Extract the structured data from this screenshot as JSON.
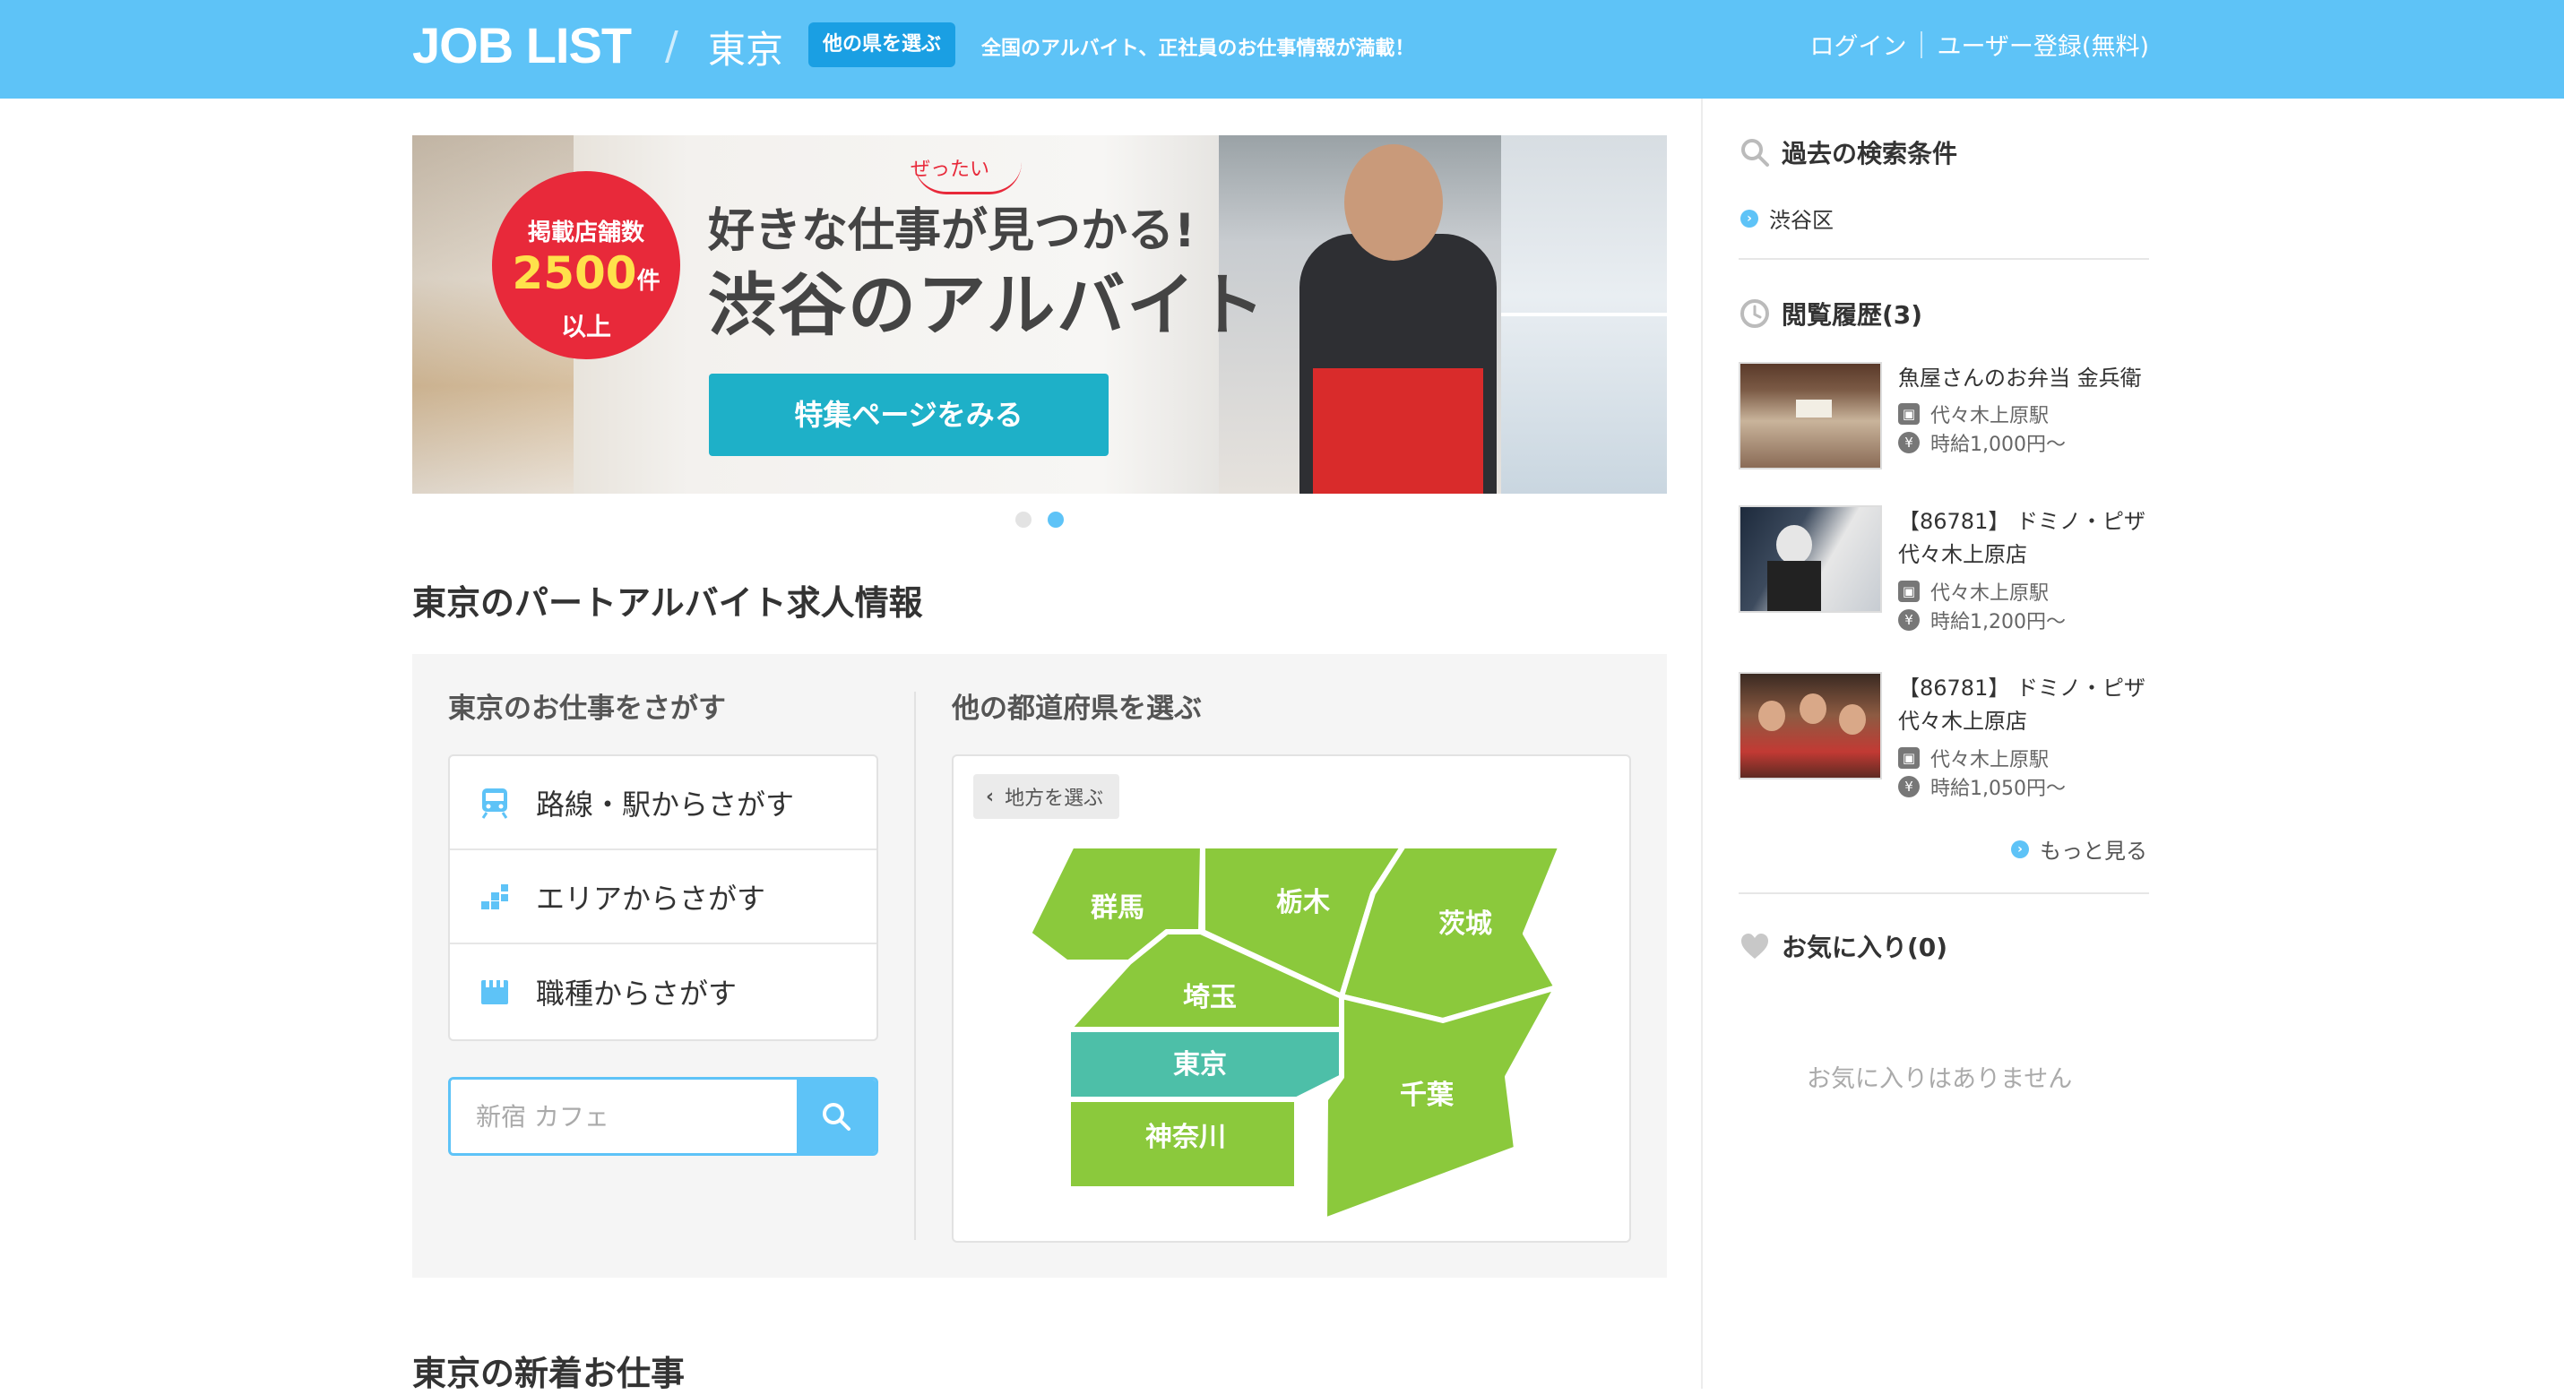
{
  "header": {
    "logo": "JOB LIST",
    "divider": "/",
    "prefecture": "東京",
    "change_pref_button": "他の県を選ぶ",
    "tagline": "全国のアルバイト、正社員のお仕事情報が満載！",
    "login": "ログイン",
    "register": "ユーザー登録(無料)"
  },
  "banner": {
    "badge_line1": "掲載店舗数",
    "badge_count": "2500",
    "badge_unit": "件",
    "badge_line3": "以上",
    "ruby": "ぜったい",
    "headline1": "好きな仕事が見つかる!",
    "headline2": "渋谷のアルバイト",
    "cta": "特集ページをみる",
    "slides": 2,
    "active_slide": 2
  },
  "main": {
    "section_title": "東京のパートアルバイト求人情報",
    "search_col_title": "東京のお仕事をさがす",
    "search_methods": [
      {
        "label": "路線・駅からさがす",
        "icon": "train-icon"
      },
      {
        "label": "エリアからさがす",
        "icon": "area-icon"
      },
      {
        "label": "職種からさがす",
        "icon": "job-category-icon"
      }
    ],
    "search_placeholder": "新宿 カフェ",
    "map_col_title": "他の都道府県を選ぶ",
    "region_button": "地方を選ぶ",
    "prefectures": [
      "群馬",
      "栃木",
      "茨城",
      "埼玉",
      "東京",
      "千葉",
      "神奈川"
    ],
    "selected_prefecture": "東京",
    "new_jobs_title": "東京の新着お仕事"
  },
  "sidebar": {
    "past_search_title": "過去の検索条件",
    "past_searches": [
      "渋谷区"
    ],
    "history_title": "閲覧履歴(3)",
    "history": [
      {
        "title": "魚屋さんのお弁当 金兵衛",
        "station": "代々木上原駅",
        "wage": "時給1,000円〜"
      },
      {
        "title": "【86781】 ドミノ・ピザ 代々木上原店",
        "station": "代々木上原駅",
        "wage": "時給1,200円〜"
      },
      {
        "title": "【86781】 ドミノ・ピザ 代々木上原店",
        "station": "代々木上原駅",
        "wage": "時給1,050円〜"
      }
    ],
    "more_link": "もっと見る",
    "favorites_title": "お気に入り(0)",
    "favorites_empty": "お気に入りはありません"
  },
  "colors": {
    "header_bg": "#5ec3f7",
    "accent": "#1a9fe3",
    "map_green": "#8bc93c",
    "map_selected": "#4dbfa8",
    "banner_red": "#e8293a",
    "banner_cta": "#1eb0c8"
  }
}
